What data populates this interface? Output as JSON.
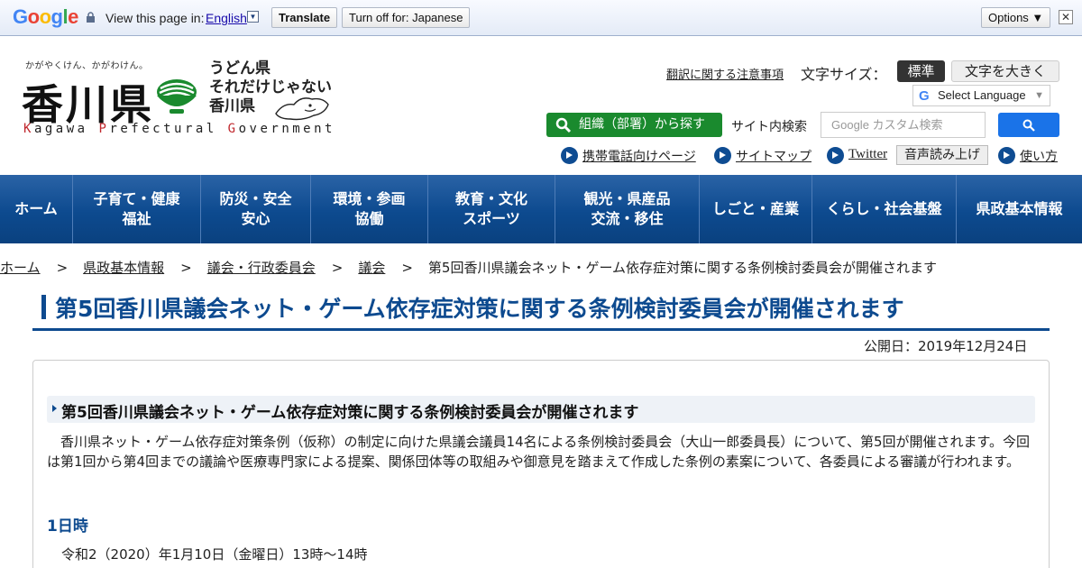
{
  "translate_bar": {
    "view_text": "View this page in:",
    "language": "English",
    "translate_label": "Translate",
    "turn_off_label": "Turn off for: Japanese",
    "options_label": "Options ▼",
    "close_label": "✕"
  },
  "header": {
    "slogan": "かがやくけん、かがわけん。",
    "logo_kanji": "香川県",
    "tagline_lines": [
      "うどん県",
      "それだけじゃない",
      "香川県"
    ],
    "logo_en_parts": [
      "K",
      "agawa ",
      "P",
      "refectural ",
      "G",
      "overnment"
    ],
    "translation_note": "翻訳に関する注意事項",
    "font_size_label": "文字サイズ：",
    "font_size_standard": "標準",
    "font_size_large": "文字を大きく",
    "select_language": "Select Language",
    "org_search": "組織（部署）から探す",
    "site_search_label": "サイト内検索",
    "search_placeholder": "Google カスタム検索",
    "links": {
      "mobile": "携帯電話向けページ",
      "sitemap": "サイトマップ",
      "twitter": "Twitter",
      "voice": "音声読み上げ",
      "howto": "使い方"
    }
  },
  "nav": [
    {
      "lines": [
        "ホーム"
      ]
    },
    {
      "lines": [
        "子育て・健康",
        "福祉"
      ]
    },
    {
      "lines": [
        "防災・安全",
        "安心"
      ]
    },
    {
      "lines": [
        "環境・参画",
        "協働"
      ]
    },
    {
      "lines": [
        "教育・文化",
        "スポーツ"
      ]
    },
    {
      "lines": [
        "観光・県産品",
        "交流・移住"
      ]
    },
    {
      "lines": [
        "しごと・産業"
      ]
    },
    {
      "lines": [
        "くらし・社会基盤"
      ]
    },
    {
      "lines": [
        "県政基本情報"
      ]
    }
  ],
  "breadcrumb": {
    "items": [
      "ホーム",
      "県政基本情報",
      "議会・行政委員会",
      "議会"
    ],
    "current": "第5回香川県議会ネット・ゲーム依存症対策に関する条例検討委員会が開催されます",
    "separator": ">"
  },
  "content": {
    "title": "第5回香川県議会ネット・ゲーム依存症対策に関する条例検討委員会が開催されます",
    "published": "公開日：2019年12月24日",
    "subtitle": "第5回香川県議会ネット・ゲーム依存症対策に関する条例検討委員会が開催されます",
    "paragraph": "香川県ネット・ゲーム依存症対策条例（仮称）の制定に向けた県議会議員14名による条例検討委員会（大山一郎委員長）について、第5回が開催されます。今回は第1回から第4回までの議論や医療専門家による提案、関係団体等の取組みや御意見を踏まえて作成した条例の素案について、各委員による審議が行われます。",
    "section_heading": "1日時",
    "date_text": "令和2（2020）年1月10日（金曜日）13時～14時"
  },
  "colors": {
    "brand_blue": "#0d4a8f",
    "search_green": "#1a8a2e",
    "google_blue": "#1a73e8"
  }
}
